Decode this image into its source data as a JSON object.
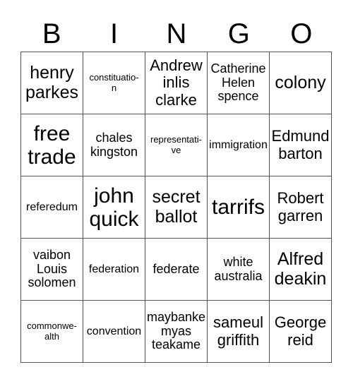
{
  "header": {
    "letters": [
      "B",
      "I",
      "N",
      "G",
      "O"
    ]
  },
  "grid": {
    "rows": [
      [
        {
          "text": "henry parkes",
          "size": "xl"
        },
        {
          "text": "constituatio-\nn",
          "size": "xs"
        },
        {
          "text": "Andrew inlis clarke",
          "size": "lg"
        },
        {
          "text": "Catherine Helen spence",
          "size": "md"
        },
        {
          "text": "colony",
          "size": "xl"
        }
      ],
      [
        {
          "text": "free trade",
          "size": "xxl"
        },
        {
          "text": "chales kingston",
          "size": "md"
        },
        {
          "text": "representati-\nve",
          "size": "xs"
        },
        {
          "text": "immigration",
          "size": "sm"
        },
        {
          "text": "Edmund barton",
          "size": "lg"
        }
      ],
      [
        {
          "text": "referedum",
          "size": "sm"
        },
        {
          "text": "john quick",
          "size": "xxl"
        },
        {
          "text": "secret ballot",
          "size": "xl"
        },
        {
          "text": "tarrifs",
          "size": "xxl"
        },
        {
          "text": "Robert garren",
          "size": "lg"
        }
      ],
      [
        {
          "text": "vaibon Louis solomen",
          "size": "md"
        },
        {
          "text": "federation",
          "size": "sm"
        },
        {
          "text": "federate",
          "size": "md"
        },
        {
          "text": "white australia",
          "size": "md"
        },
        {
          "text": "Alfred deakin",
          "size": "xl"
        }
      ],
      [
        {
          "text": "commonwe-\nalth",
          "size": "xs"
        },
        {
          "text": "convention",
          "size": "sm"
        },
        {
          "text": "maybanke myas teakame",
          "size": "md"
        },
        {
          "text": "sameul griffith",
          "size": "lg"
        },
        {
          "text": "George reid",
          "size": "lg"
        }
      ]
    ]
  }
}
